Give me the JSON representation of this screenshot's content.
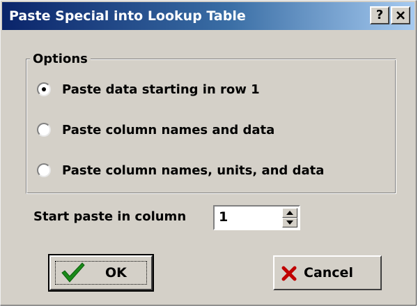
{
  "window": {
    "title": "Paste Special into Lookup Table",
    "help_label": "?",
    "close_label": "✕"
  },
  "options": {
    "legend": "Options",
    "items": [
      {
        "label": "Paste data starting in row 1",
        "checked": true
      },
      {
        "label": "Paste column names and data",
        "checked": false
      },
      {
        "label": "Paste column names, units, and data",
        "checked": false
      }
    ]
  },
  "start_column": {
    "label": "Start paste in column",
    "value": "1"
  },
  "buttons": {
    "ok_label": "OK",
    "cancel_label": "Cancel"
  },
  "colors": {
    "title_gradient_start": "#0a246a",
    "dialog_face": "#d4d0c8",
    "ok_check": "#1a8a1a",
    "cancel_x": "#c00000"
  }
}
